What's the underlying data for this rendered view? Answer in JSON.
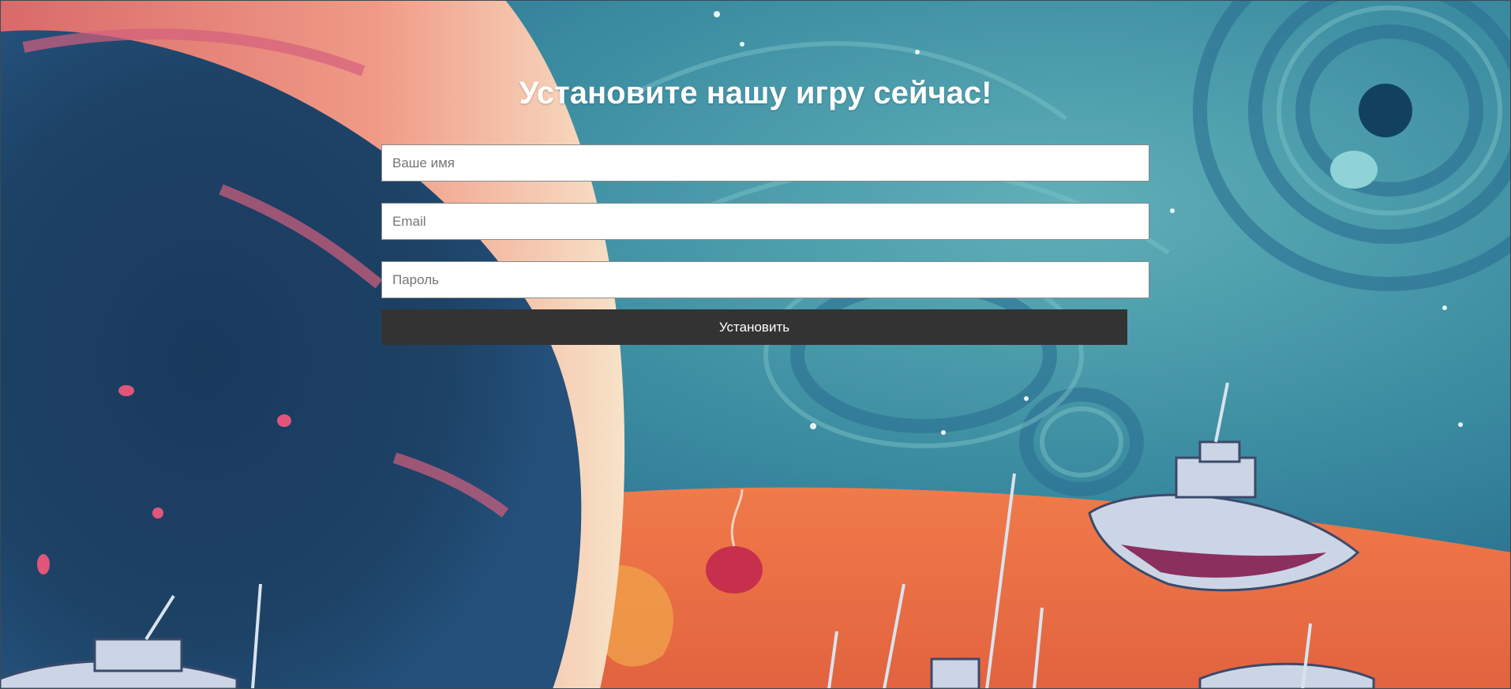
{
  "page": {
    "title": "Установите нашу игру сейчас!"
  },
  "form": {
    "name_placeholder": "Ваше имя",
    "email_placeholder": "Email",
    "password_placeholder": "Пароль",
    "submit_label": "Установить",
    "button_color": "#333333"
  },
  "background": {
    "description_icon": "space-scene-illustration"
  }
}
